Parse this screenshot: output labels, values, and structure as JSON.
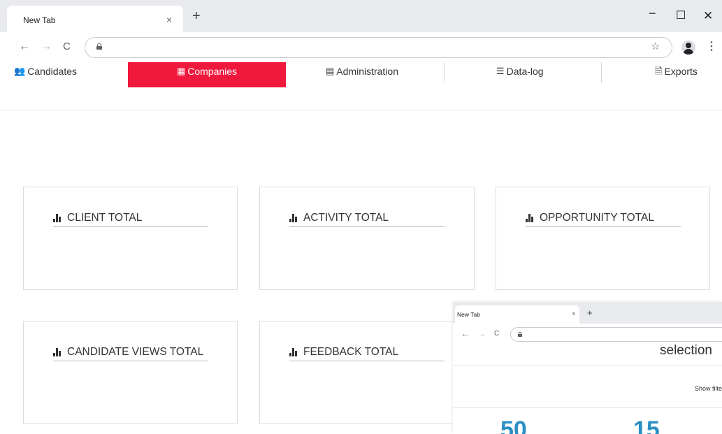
{
  "browser": {
    "tab_title": "New Tab",
    "tab_close": "×",
    "new_tab": "+",
    "window_minimize": "−",
    "window_maximize": "☐",
    "window_close": "✕",
    "back": "←",
    "forward": "→",
    "reload": "C",
    "star": "☆",
    "menu": "⋮"
  },
  "nav": {
    "items": [
      {
        "label": "Candidates",
        "icon": "users-icon",
        "glyph": "👥"
      },
      {
        "label": "Companies",
        "icon": "building-icon",
        "glyph": "▦",
        "active": true
      },
      {
        "label": "Administration",
        "icon": "calculator-icon",
        "glyph": "▤"
      },
      {
        "label": "Data-log",
        "icon": "list-icon",
        "glyph": "☰"
      },
      {
        "label": "Exports",
        "icon": "file-export-icon",
        "glyph": "🗎"
      }
    ],
    "active_color": "#f0183c"
  },
  "cards": [
    {
      "title": "CLIENT TOTAL",
      "icon": "bar-chart-icon"
    },
    {
      "title": "ACTIVITY TOTAL",
      "icon": "bar-chart-icon"
    },
    {
      "title": "OPPORTUNITY TOTAL",
      "icon": "bar-chart-icon"
    },
    {
      "title": "CANDIDATE VIEWS TOTAL",
      "icon": "bar-chart-icon"
    },
    {
      "title": "FEEDBACK TOTAL",
      "icon": "bar-chart-icon"
    }
  ],
  "overlay": {
    "tab_title": "New Tab",
    "tab_close": "×",
    "new_tab": "+",
    "back": "←",
    "forward": "→",
    "reload": "C",
    "heading": "selection",
    "show_filter": "Show filte",
    "stats": [
      "50",
      "15"
    ],
    "stat_color": "#2b8fc4"
  }
}
